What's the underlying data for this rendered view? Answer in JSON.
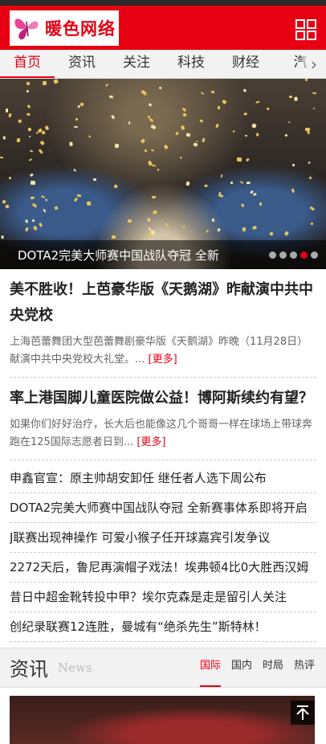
{
  "header": {
    "logo_text": "暖色网络",
    "logo_icon": "butterfly-logo-icon",
    "menu_icon": "grid-menu-icon"
  },
  "nav": {
    "items": [
      {
        "label": "首页",
        "active": true
      },
      {
        "label": "资讯",
        "active": false
      },
      {
        "label": "关注",
        "active": false
      },
      {
        "label": "科技",
        "active": false
      },
      {
        "label": "财经",
        "active": false
      },
      {
        "label": "汽",
        "active": false
      }
    ],
    "arrow_icon": "chevron-right-icon"
  },
  "banner": {
    "caption": "DOTA2完美大师赛中国战队夺冠 全新",
    "dots_total": 5,
    "dots_active_index": 3
  },
  "articles": [
    {
      "title": "美不胜收！上芭豪华版《天鹅湖》昨献演中共中央党校",
      "summary": "上海芭蕾舞团大型芭蕾舞剧豪华版《天鹅湖》昨晚（11月28日）献演中共中央党校大礼堂。... ",
      "more": "[更多]"
    },
    {
      "title": "率上港国脚儿童医院做公益！博阿斯续约有望？",
      "summary": "如果你们好好治疗，长大后也能像这几个哥哥一样在球场上带球奔跑在125国际志愿者日到... ",
      "more": "[更多]"
    }
  ],
  "headlines": [
    "申鑫官宣：原主帅胡安卸任 继任者人选下周公布",
    "DOTA2完美大师赛中国战队夺冠 全新赛事体系即将开启",
    "J联赛出现神操作 可爱小猴子任开球嘉宾引发争议",
    "2272天后，鲁尼再演帽子戏法！埃弗顿4比0大胜西汉姆",
    "昔日中超金靴转投中甲？埃尔克森是走是留引人关注",
    "创纪录联赛12连胜，曼城有“绝杀先生”斯特林！"
  ],
  "section": {
    "title": "资讯",
    "subtitle": "News",
    "tabs": [
      {
        "label": "国际",
        "active": true
      },
      {
        "label": "国内",
        "active": false
      },
      {
        "label": "时局",
        "active": false
      },
      {
        "label": "热评",
        "active": false
      }
    ]
  },
  "back_to_top_icon": "back-to-top-icon",
  "colors": {
    "brand": "#e60012",
    "nav_bg": "#f2f2f2"
  }
}
